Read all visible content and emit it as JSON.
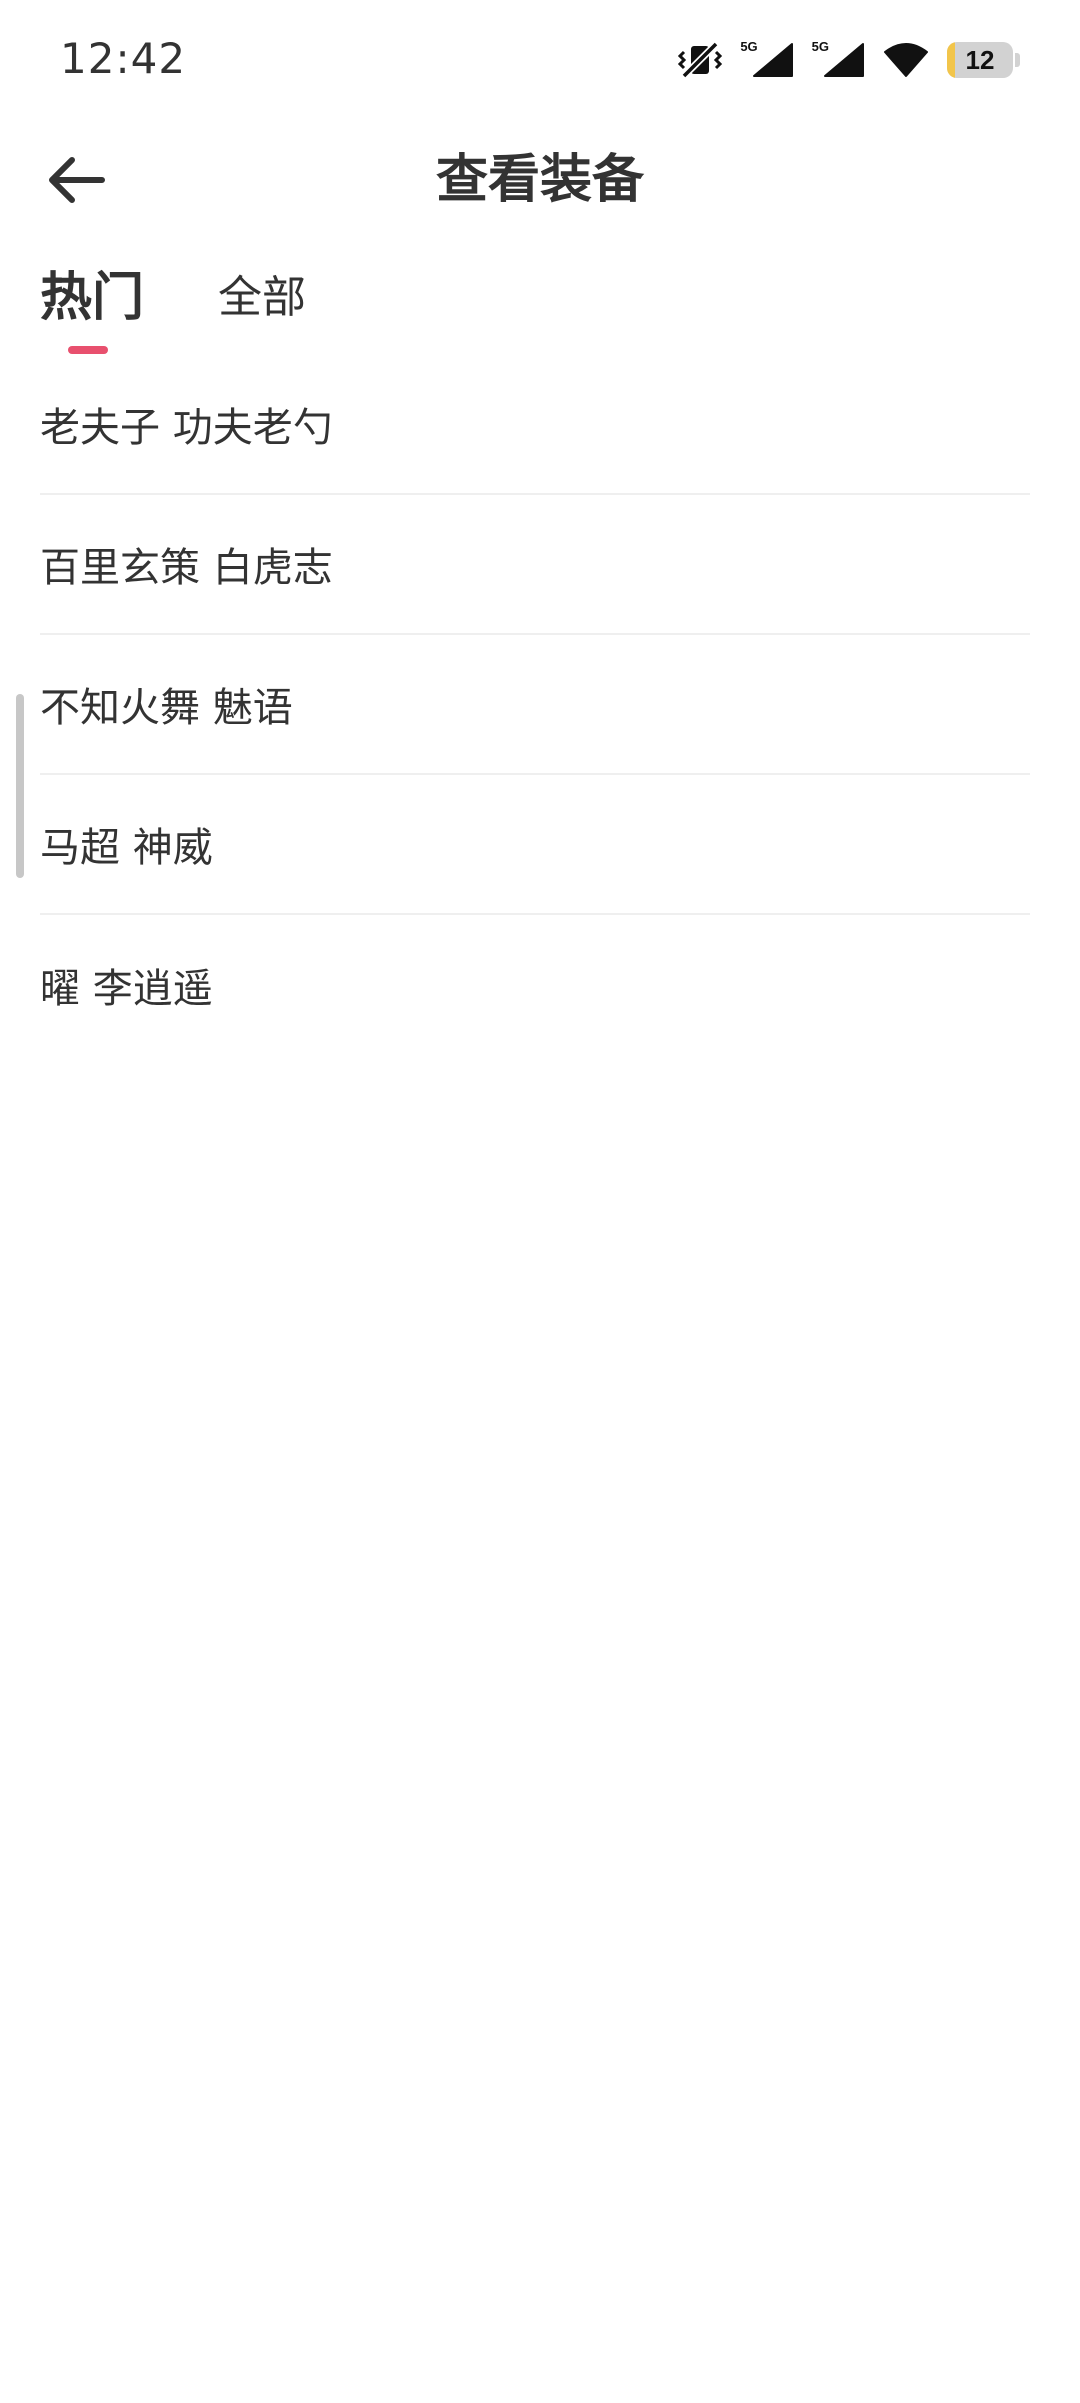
{
  "status_bar": {
    "time": "12:42",
    "network_1": "5G",
    "network_2": "5G",
    "battery_level": "12",
    "battery_fraction": 0.12
  },
  "header": {
    "title": "查看装备",
    "back_icon": "arrow-left-icon"
  },
  "tabs": [
    {
      "label": "热门",
      "active": true
    },
    {
      "label": "全部",
      "active": false
    }
  ],
  "colors": {
    "accent": "#e8506e",
    "text": "#333333",
    "divider": "#efefef",
    "battery_fill": "#f2c54a"
  },
  "list": {
    "items": [
      {
        "label": "老夫子 功夫老勺"
      },
      {
        "label": "百里玄策 白虎志"
      },
      {
        "label": "不知火舞 魅语"
      },
      {
        "label": "马超 神威"
      },
      {
        "label": "曜 李逍遥"
      }
    ]
  }
}
